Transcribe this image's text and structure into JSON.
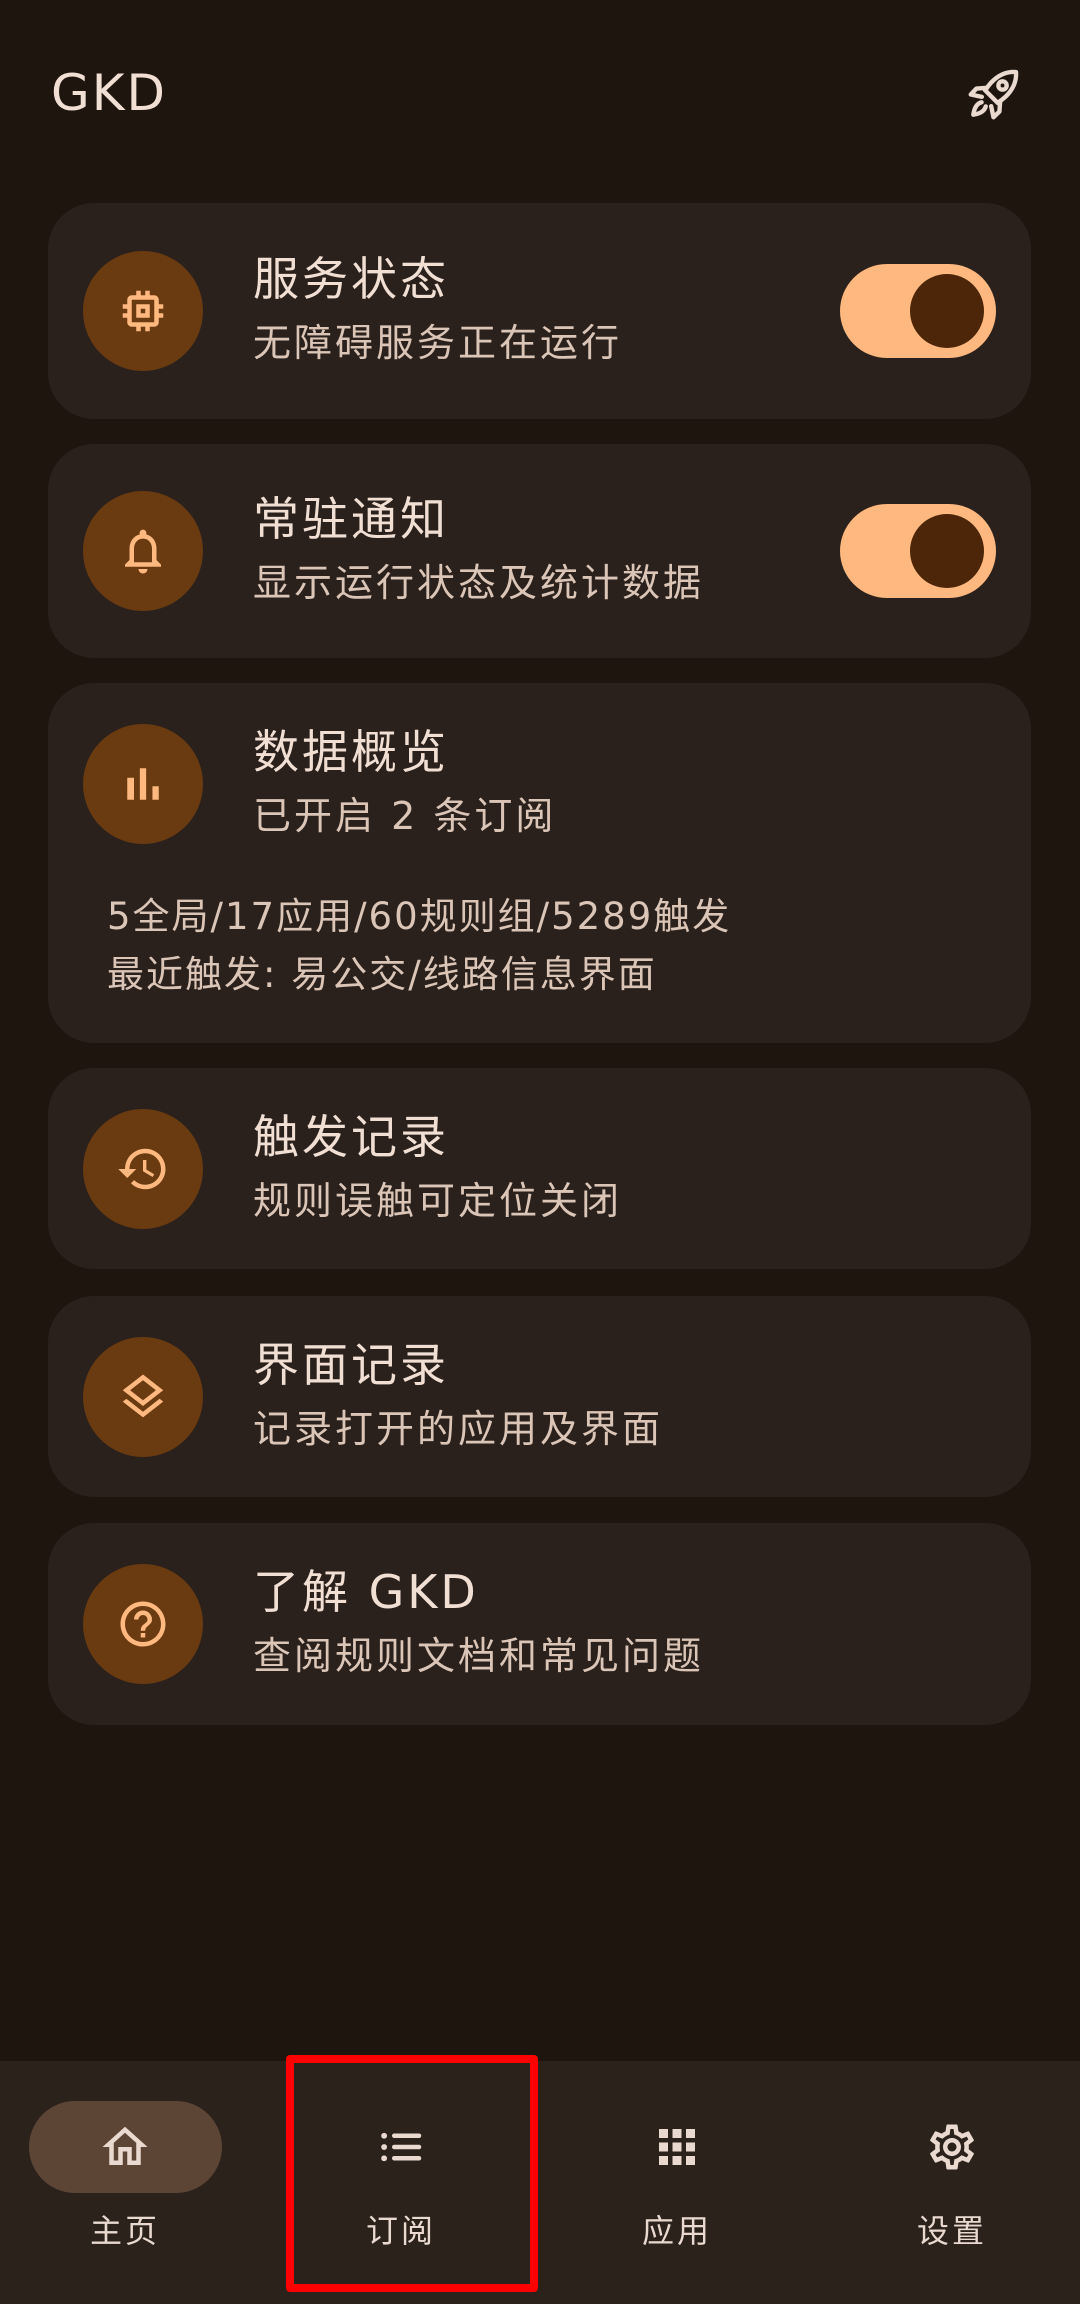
{
  "theme": {
    "background": "#1e150f",
    "card": "#2a211c",
    "icon_bg": "#6a3a10",
    "accent": "#ffb87f",
    "knob": "#4d2609",
    "text": "#f1dfd4",
    "subtext": "#dbc5b7",
    "nav_bg": "#2b221c",
    "nav_active": "#5d4535",
    "nav_fg": "#e9d9cf",
    "highlight": "#ff0000"
  },
  "header": {
    "title": "GKD",
    "action_icon": "rocket-icon"
  },
  "cards": [
    {
      "title": "服务状态",
      "subtitle": "无障碍服务正在运行",
      "icon": "chip-icon",
      "toggle": {
        "checked": true
      }
    },
    {
      "title": "常驻通知",
      "subtitle": "显示运行状态及统计数据",
      "icon": "bell-icon",
      "toggle": {
        "checked": true
      }
    },
    {
      "title": "数据概览",
      "subtitle": "已开启 2 条订阅",
      "icon": "bar-chart-icon",
      "details": [
        "5全局/17应用/60规则组/5289触发",
        "最近触发: 易公交/线路信息界面"
      ]
    },
    {
      "title": "触发记录",
      "subtitle": "规则误触可定位关闭",
      "icon": "history-icon"
    },
    {
      "title": "界面记录",
      "subtitle": "记录打开的应用及界面",
      "icon": "layers-icon"
    },
    {
      "title": "了解 GKD",
      "subtitle": "查阅规则文档和常见问题",
      "icon": "help-icon"
    }
  ],
  "nav": {
    "items": [
      {
        "label": "主页",
        "icon": "home-icon",
        "active": true
      },
      {
        "label": "订阅",
        "icon": "list-icon",
        "active": false
      },
      {
        "label": "应用",
        "icon": "apps-grid-icon",
        "active": false
      },
      {
        "label": "设置",
        "icon": "gear-icon",
        "active": false
      }
    ]
  }
}
